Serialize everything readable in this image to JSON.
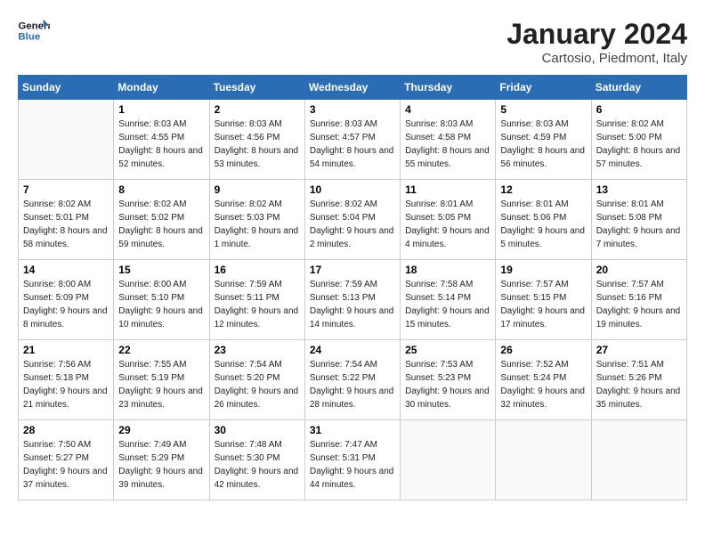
{
  "header": {
    "logo_line1": "General",
    "logo_line2": "Blue",
    "month_title": "January 2024",
    "location": "Cartosio, Piedmont, Italy"
  },
  "weekdays": [
    "Sunday",
    "Monday",
    "Tuesday",
    "Wednesday",
    "Thursday",
    "Friday",
    "Saturday"
  ],
  "weeks": [
    [
      {
        "day": "",
        "sunrise": "",
        "sunset": "",
        "daylight": ""
      },
      {
        "day": "1",
        "sunrise": "Sunrise: 8:03 AM",
        "sunset": "Sunset: 4:55 PM",
        "daylight": "Daylight: 8 hours and 52 minutes."
      },
      {
        "day": "2",
        "sunrise": "Sunrise: 8:03 AM",
        "sunset": "Sunset: 4:56 PM",
        "daylight": "Daylight: 8 hours and 53 minutes."
      },
      {
        "day": "3",
        "sunrise": "Sunrise: 8:03 AM",
        "sunset": "Sunset: 4:57 PM",
        "daylight": "Daylight: 8 hours and 54 minutes."
      },
      {
        "day": "4",
        "sunrise": "Sunrise: 8:03 AM",
        "sunset": "Sunset: 4:58 PM",
        "daylight": "Daylight: 8 hours and 55 minutes."
      },
      {
        "day": "5",
        "sunrise": "Sunrise: 8:03 AM",
        "sunset": "Sunset: 4:59 PM",
        "daylight": "Daylight: 8 hours and 56 minutes."
      },
      {
        "day": "6",
        "sunrise": "Sunrise: 8:02 AM",
        "sunset": "Sunset: 5:00 PM",
        "daylight": "Daylight: 8 hours and 57 minutes."
      }
    ],
    [
      {
        "day": "7",
        "sunrise": "Sunrise: 8:02 AM",
        "sunset": "Sunset: 5:01 PM",
        "daylight": "Daylight: 8 hours and 58 minutes."
      },
      {
        "day": "8",
        "sunrise": "Sunrise: 8:02 AM",
        "sunset": "Sunset: 5:02 PM",
        "daylight": "Daylight: 8 hours and 59 minutes."
      },
      {
        "day": "9",
        "sunrise": "Sunrise: 8:02 AM",
        "sunset": "Sunset: 5:03 PM",
        "daylight": "Daylight: 9 hours and 1 minute."
      },
      {
        "day": "10",
        "sunrise": "Sunrise: 8:02 AM",
        "sunset": "Sunset: 5:04 PM",
        "daylight": "Daylight: 9 hours and 2 minutes."
      },
      {
        "day": "11",
        "sunrise": "Sunrise: 8:01 AM",
        "sunset": "Sunset: 5:05 PM",
        "daylight": "Daylight: 9 hours and 4 minutes."
      },
      {
        "day": "12",
        "sunrise": "Sunrise: 8:01 AM",
        "sunset": "Sunset: 5:06 PM",
        "daylight": "Daylight: 9 hours and 5 minutes."
      },
      {
        "day": "13",
        "sunrise": "Sunrise: 8:01 AM",
        "sunset": "Sunset: 5:08 PM",
        "daylight": "Daylight: 9 hours and 7 minutes."
      }
    ],
    [
      {
        "day": "14",
        "sunrise": "Sunrise: 8:00 AM",
        "sunset": "Sunset: 5:09 PM",
        "daylight": "Daylight: 9 hours and 8 minutes."
      },
      {
        "day": "15",
        "sunrise": "Sunrise: 8:00 AM",
        "sunset": "Sunset: 5:10 PM",
        "daylight": "Daylight: 9 hours and 10 minutes."
      },
      {
        "day": "16",
        "sunrise": "Sunrise: 7:59 AM",
        "sunset": "Sunset: 5:11 PM",
        "daylight": "Daylight: 9 hours and 12 minutes."
      },
      {
        "day": "17",
        "sunrise": "Sunrise: 7:59 AM",
        "sunset": "Sunset: 5:13 PM",
        "daylight": "Daylight: 9 hours and 14 minutes."
      },
      {
        "day": "18",
        "sunrise": "Sunrise: 7:58 AM",
        "sunset": "Sunset: 5:14 PM",
        "daylight": "Daylight: 9 hours and 15 minutes."
      },
      {
        "day": "19",
        "sunrise": "Sunrise: 7:57 AM",
        "sunset": "Sunset: 5:15 PM",
        "daylight": "Daylight: 9 hours and 17 minutes."
      },
      {
        "day": "20",
        "sunrise": "Sunrise: 7:57 AM",
        "sunset": "Sunset: 5:16 PM",
        "daylight": "Daylight: 9 hours and 19 minutes."
      }
    ],
    [
      {
        "day": "21",
        "sunrise": "Sunrise: 7:56 AM",
        "sunset": "Sunset: 5:18 PM",
        "daylight": "Daylight: 9 hours and 21 minutes."
      },
      {
        "day": "22",
        "sunrise": "Sunrise: 7:55 AM",
        "sunset": "Sunset: 5:19 PM",
        "daylight": "Daylight: 9 hours and 23 minutes."
      },
      {
        "day": "23",
        "sunrise": "Sunrise: 7:54 AM",
        "sunset": "Sunset: 5:20 PM",
        "daylight": "Daylight: 9 hours and 26 minutes."
      },
      {
        "day": "24",
        "sunrise": "Sunrise: 7:54 AM",
        "sunset": "Sunset: 5:22 PM",
        "daylight": "Daylight: 9 hours and 28 minutes."
      },
      {
        "day": "25",
        "sunrise": "Sunrise: 7:53 AM",
        "sunset": "Sunset: 5:23 PM",
        "daylight": "Daylight: 9 hours and 30 minutes."
      },
      {
        "day": "26",
        "sunrise": "Sunrise: 7:52 AM",
        "sunset": "Sunset: 5:24 PM",
        "daylight": "Daylight: 9 hours and 32 minutes."
      },
      {
        "day": "27",
        "sunrise": "Sunrise: 7:51 AM",
        "sunset": "Sunset: 5:26 PM",
        "daylight": "Daylight: 9 hours and 35 minutes."
      }
    ],
    [
      {
        "day": "28",
        "sunrise": "Sunrise: 7:50 AM",
        "sunset": "Sunset: 5:27 PM",
        "daylight": "Daylight: 9 hours and 37 minutes."
      },
      {
        "day": "29",
        "sunrise": "Sunrise: 7:49 AM",
        "sunset": "Sunset: 5:29 PM",
        "daylight": "Daylight: 9 hours and 39 minutes."
      },
      {
        "day": "30",
        "sunrise": "Sunrise: 7:48 AM",
        "sunset": "Sunset: 5:30 PM",
        "daylight": "Daylight: 9 hours and 42 minutes."
      },
      {
        "day": "31",
        "sunrise": "Sunrise: 7:47 AM",
        "sunset": "Sunset: 5:31 PM",
        "daylight": "Daylight: 9 hours and 44 minutes."
      },
      {
        "day": "",
        "sunrise": "",
        "sunset": "",
        "daylight": ""
      },
      {
        "day": "",
        "sunrise": "",
        "sunset": "",
        "daylight": ""
      },
      {
        "day": "",
        "sunrise": "",
        "sunset": "",
        "daylight": ""
      }
    ]
  ]
}
